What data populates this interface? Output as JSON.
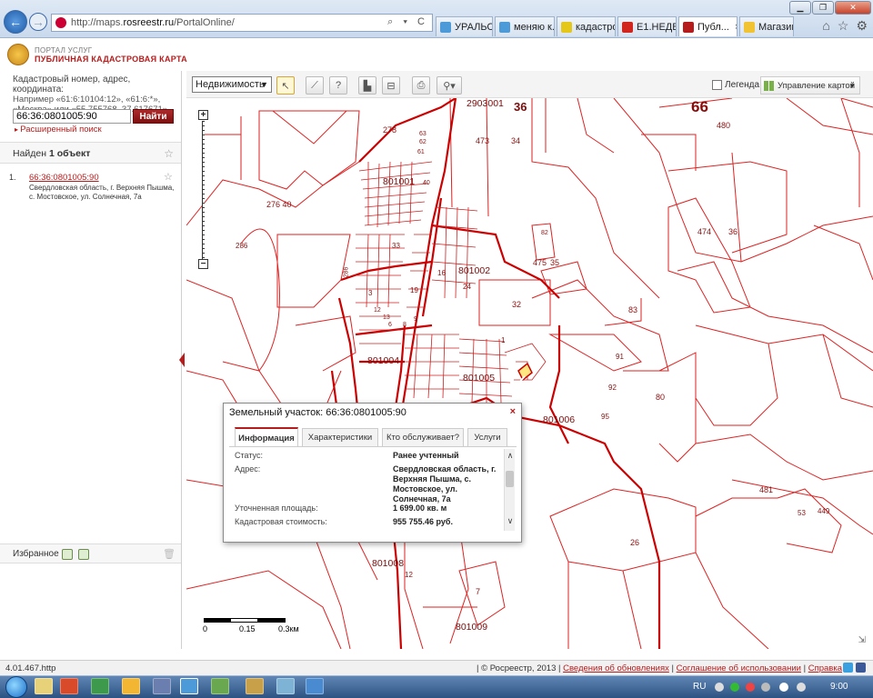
{
  "browser": {
    "url_prefix": "http://maps.",
    "url_domain": "rosreestr.ru",
    "url_suffix": "/PortalOnline/",
    "address_icons": "⌕ ▾ C",
    "tabs": [
      {
        "label": "УРАЛЬС...",
        "color": "#4c9ad8"
      },
      {
        "label": "меняю к...",
        "color": "#4c9ad8"
      },
      {
        "label": "кадастро...",
        "color": "#e5c71a"
      },
      {
        "label": "E1.НЕДВ...",
        "color": "#d0261e"
      },
      {
        "label": "Публ...",
        "color": "#b71c1c"
      },
      {
        "label": "Магазин...",
        "color": "#f1c232"
      }
    ]
  },
  "portal": {
    "subtitle": "ПОРТАЛ УСЛУГ",
    "title": "ПУБЛИЧНАЯ КАДАСТРОВАЯ КАРТА"
  },
  "search": {
    "hint_title": "Кадастровый номер, адрес, координата:",
    "hint_examples": "Например «61:6:10104:12», «61:6:*», «Москва» или «55.755768, 37.617671»",
    "value": "66:36:0801005:90",
    "button": "Найти",
    "advanced": "Расширенный поиск"
  },
  "results": {
    "found_prefix": "Найден ",
    "found_count": "1 объект",
    "items": [
      {
        "num": "1.",
        "id": "66:36:0801005:90",
        "address": "Свердловская область, г. Верхняя Пышма, с. Мостовское, ул. Солнечная, 7а"
      }
    ]
  },
  "favorites": {
    "label": "Избранное"
  },
  "toolbar": {
    "layer": "Недвижимость",
    "legend": "Легенда",
    "map_control": "Управление картой"
  },
  "map": {
    "labels": [
      "2903001",
      "36",
      "66",
      "480",
      "278",
      "473",
      "34",
      "62",
      "63",
      "61",
      "801001",
      "40",
      "276 40",
      "474",
      "36",
      "475",
      "35",
      "82",
      "801002",
      "286",
      "33",
      "16",
      "24",
      "32",
      "19",
      "83",
      "3",
      "801004",
      "1",
      "801005",
      "91",
      "92",
      "80",
      "801006",
      "95",
      "481",
      "53",
      "449",
      "26",
      "801008",
      "12",
      "7",
      "801009",
      "286",
      "12",
      "13",
      "6",
      "8",
      "9"
    ],
    "scale": {
      "zero": "0",
      "mid": "0.15",
      "end": "0.3км"
    }
  },
  "popup": {
    "title": "Земельный участок: 66:36:0801005:90",
    "tabs": [
      "Информация",
      "Характеристики",
      "Кто обслуживает?",
      "Услуги"
    ],
    "rows": [
      {
        "label": "Статус:",
        "value": "Ранее учтенный"
      },
      {
        "label": "Адрес:",
        "value": "Свердловская область, г. Верхняя Пышма, с. Мостовское, ул. Солнечная, 7а"
      },
      {
        "label": "Уточненная площадь:",
        "value": "1 699.00 кв. м"
      },
      {
        "label": "Кадастровая стоимость:",
        "value": "955 755.46 руб."
      }
    ]
  },
  "status": {
    "left": "4.01.467.http",
    "copyright": "| © Росреестр, 2013 | ",
    "updates": "Сведения об обновлениях",
    "sep": " | ",
    "agreement": "Соглашение об использовании",
    "help": "Справка"
  },
  "taskbar": {
    "lang": "RU",
    "time": "9:00"
  }
}
